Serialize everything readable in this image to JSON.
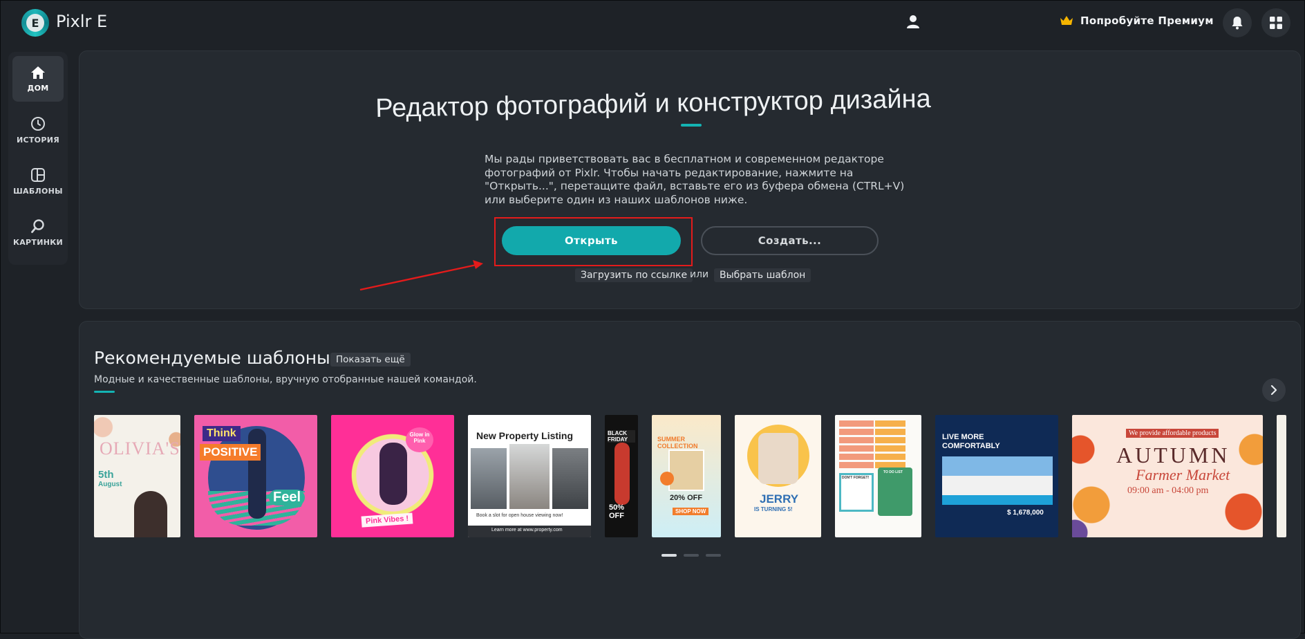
{
  "app": {
    "title": "Pixlr E",
    "logo_letter": "E"
  },
  "topbar": {
    "premium_label": "Попробуйте Премиум"
  },
  "sidebar": {
    "items": [
      {
        "label": "ДОМ",
        "icon": "home-icon"
      },
      {
        "label": "ИСТОРИЯ",
        "icon": "clock-icon"
      },
      {
        "label": "ШАБЛОНЫ",
        "icon": "templates-icon"
      },
      {
        "label": "КАРТИНКИ",
        "icon": "search-icon"
      }
    ]
  },
  "hero": {
    "title": "Редактор фотографий и конструктор дизайна",
    "description": "Мы рады приветствовать вас в бесплатном и современном редакторе фотографий от Pixlr. Чтобы начать редактирование, нажмите на \"Открыть...\", перетащите файл, вставьте его из буфера обмена (CTRL+V) или выберите один из наших шаблонов ниже.",
    "open_label": "Открыть",
    "create_label": "Создать...",
    "upload_link_label": "Загрузить по ссылке",
    "or_label": "или",
    "choose_template_label": "Выбрать шаблон"
  },
  "templates": {
    "title": "Рекомендуемые шаблоны",
    "show_more_label": "Показать ещё",
    "subtitle": "Модные и качественные шаблоны, вручную отобранные нашей командой.",
    "cards": [
      {
        "name": "OLIVIA'S",
        "line2": "5th",
        "line3": "August"
      },
      {
        "name": "Think",
        "line2": "POSITIVE",
        "line3": "Feel"
      },
      {
        "name": "Glow in Pink",
        "line2": "Pink Vibes !"
      },
      {
        "name": "New Property Listing",
        "line2": "Book a slot for open house viewing now!",
        "line3": "Learn more at www.property.com"
      },
      {
        "name": "BLACK FRIDAY",
        "line2": "50% OFF"
      },
      {
        "name": "SUMMER COLLECTION",
        "line2": "20% OFF",
        "line3": "SHOP NOW"
      },
      {
        "name": "JERRY",
        "line2": "IS TURNING 5!"
      },
      {
        "name": "TO DO LIST",
        "line2": "DON'T FORGET!"
      },
      {
        "name": "LIVE MORE COMFORTABLY",
        "line2": "$ 1,678,000"
      },
      {
        "name": "AUTUMN",
        "line2": "Farmer Market",
        "line3": "09:00 am - 04:00 pm",
        "line4": "We provide affordable products"
      }
    ]
  },
  "colors": {
    "accent": "#12a9ac",
    "background": "#1e2227",
    "card": "#252a30",
    "annotation": "#e41b1b"
  }
}
